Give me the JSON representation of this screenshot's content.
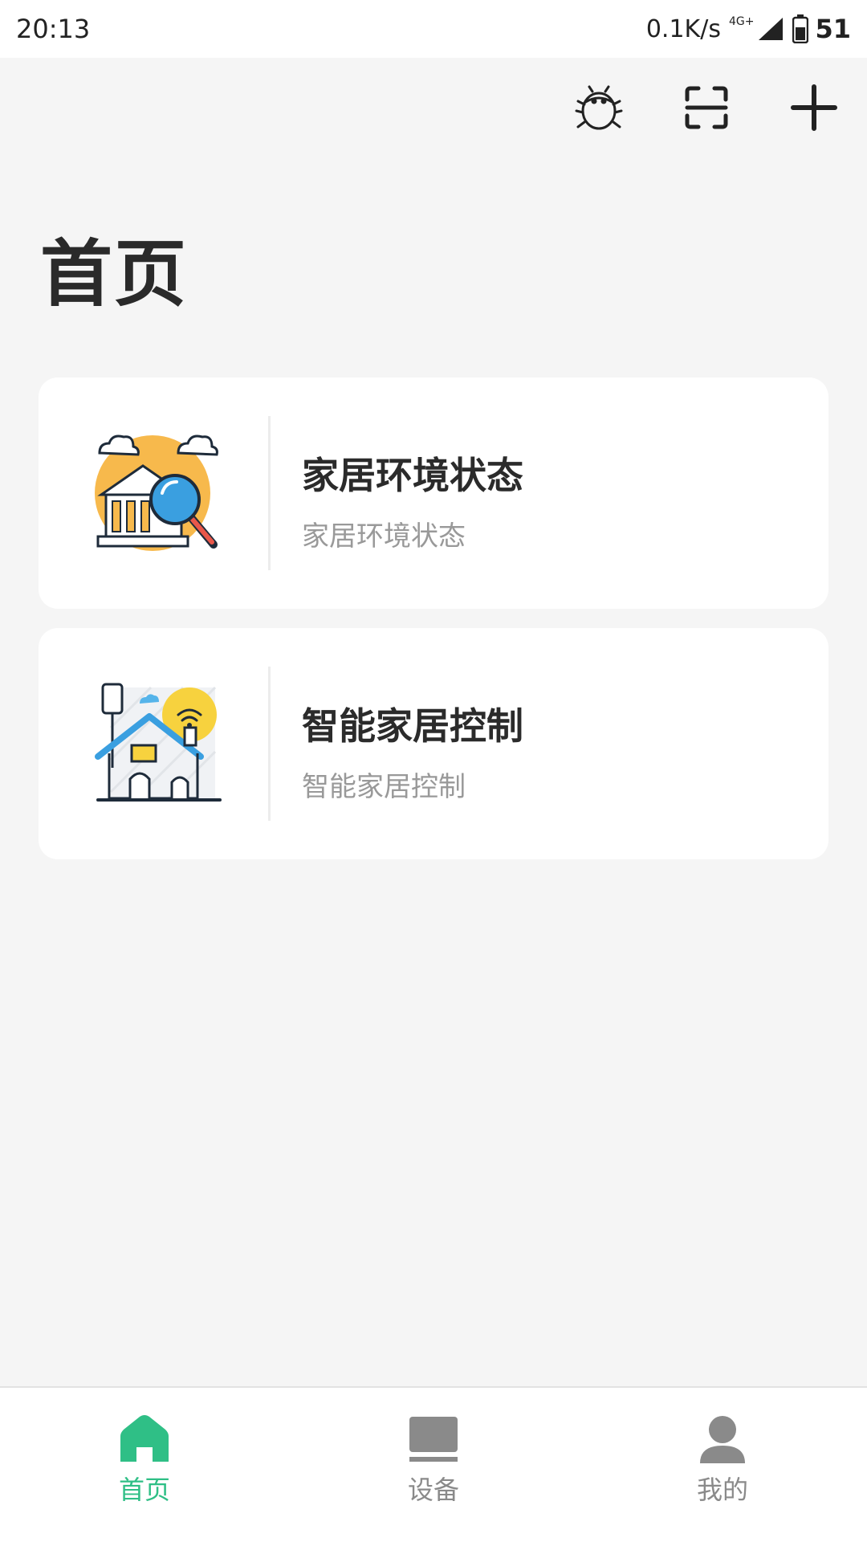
{
  "status_bar": {
    "time": "20:13",
    "net_speed": "0.1K/s",
    "network_type": "4G+",
    "battery": "51"
  },
  "top_actions": [
    {
      "icon": "bug-icon"
    },
    {
      "icon": "scan-icon"
    },
    {
      "icon": "add-icon"
    }
  ],
  "page": {
    "title": "首页"
  },
  "cards": [
    {
      "title": "家居环境状态",
      "subtitle": "家居环境状态",
      "icon": "house-search-icon"
    },
    {
      "title": "智能家居控制",
      "subtitle": "智能家居控制",
      "icon": "smart-home-icon"
    }
  ],
  "bottom_nav": {
    "items": [
      {
        "label": "首页",
        "icon": "home-icon",
        "active": true
      },
      {
        "label": "设备",
        "icon": "device-icon",
        "active": false
      },
      {
        "label": "我的",
        "icon": "user-icon",
        "active": false
      }
    ]
  },
  "colors": {
    "accent": "#2fbf86",
    "background": "#f5f5f5",
    "inactive": "#8a8a8a"
  }
}
